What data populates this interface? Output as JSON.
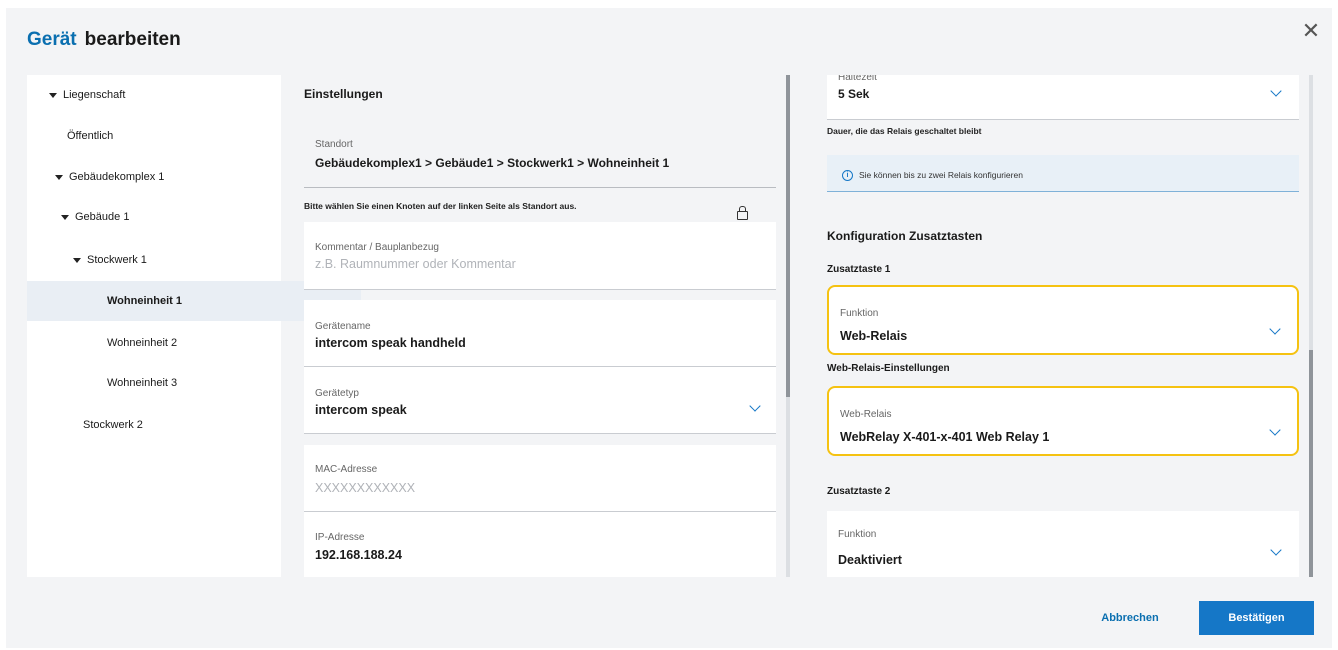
{
  "title": {
    "part1": "Gerät",
    "part2": "bearbeiten"
  },
  "close_icon": "close-icon",
  "tree": [
    {
      "label": "Liegenschaft",
      "expanded": true
    },
    {
      "label": "Öffentlich"
    },
    {
      "label": "Gebäudekomplex 1",
      "expanded": true
    },
    {
      "label": "Gebäude 1",
      "expanded": true
    },
    {
      "label": "Stockwerk 1",
      "expanded": true
    },
    {
      "label": "Wohneinheit 1",
      "selected": true
    },
    {
      "label": "Wohneinheit 2"
    },
    {
      "label": "Wohneinheit 3"
    },
    {
      "label": "Stockwerk 2"
    }
  ],
  "settings": {
    "heading": "Einstellungen",
    "standort_label": "Standort",
    "standort_value": "Gebäudekomplex1 > Gebäude1 > Stockwerk1 > Wohneinheit 1",
    "standort_hint": "Bitte wählen Sie einen Knoten auf der linken Seite als Standort aus.",
    "kommentar_label": "Kommentar / Bauplanbezug",
    "kommentar_placeholder": "z.B. Raumnummer oder Kommentar",
    "geraetename_label": "Gerätename",
    "geraetename_value": "intercom speak handheld",
    "geraetetyp_label": "Gerätetyp",
    "geraetetyp_value": "intercom speak",
    "mac_label": "MAC-Adresse",
    "mac_placeholder": "XXXXXXXXXXXX",
    "ip_label": "IP-Adresse",
    "ip_value": "192.168.188.24"
  },
  "relay": {
    "haltezeit_label": "Haltezeit",
    "haltezeit_value": "5 Sek",
    "haltezeit_hint": "Dauer, die das Relais geschaltet bleibt",
    "info_text": "Sie können bis zu zwei Relais konfigurieren",
    "info_icon": "i"
  },
  "zusatz": {
    "heading": "Konfiguration Zusatztasten",
    "taste1_heading": "Zusatztaste 1",
    "funktion_label": "Funktion",
    "funktion1_value": "Web-Relais",
    "webrelais_heading": "Web-Relais-Einstellungen",
    "webrelais_label": "Web-Relais",
    "webrelais_value": "WebRelay X-401-x-401 Web Relay 1",
    "taste2_heading": "Zusatztaste 2",
    "funktion2_label": "Funktion",
    "funktion2_value": "Deaktiviert"
  },
  "buttons": {
    "cancel": "Abbrechen",
    "confirm": "Bestätigen"
  },
  "colors": {
    "accent": "#1577c7",
    "highlight": "#f5c211",
    "title_blue": "#0a6fb0"
  }
}
